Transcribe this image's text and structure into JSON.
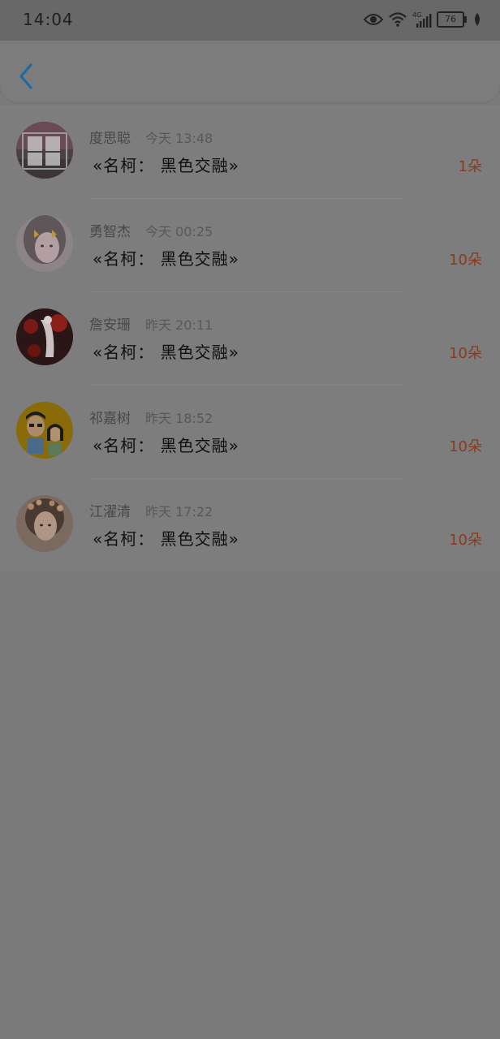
{
  "status_bar": {
    "time": "14:04",
    "network": "4G",
    "battery": "76",
    "icons": [
      "eye-icon",
      "wifi-icon",
      "signal-icon",
      "battery-icon",
      "leaf-icon"
    ]
  },
  "header": {
    "back_icon": "chevron-left-icon",
    "accent_color": "#1a6aa8"
  },
  "colors": {
    "count": "#8a3a1e",
    "title": "#0f0f0f",
    "name": "#484848"
  },
  "records": [
    {
      "name": "度思聪",
      "time": "今天 13:48",
      "title": "«名柯： 黑色交融»",
      "count": "1朵",
      "avatar": "avatar-text-image"
    },
    {
      "name": "勇智杰",
      "time": "今天 00:25",
      "title": "«名柯： 黑色交融»",
      "count": "10朵",
      "avatar": "avatar-girl-with-butterflies"
    },
    {
      "name": "詹安珊",
      "time": "昨天 20:11",
      "title": "«名柯： 黑色交融»",
      "count": "10朵",
      "avatar": "avatar-red-scene"
    },
    {
      "name": "祁嘉树",
      "time": "昨天 18:52",
      "title": "«名柯： 黑色交融»",
      "count": "10朵",
      "avatar": "avatar-cartoon-couple"
    },
    {
      "name": "江濯清",
      "time": "昨天 17:22",
      "title": "«名柯： 黑色交融»",
      "count": "10朵",
      "avatar": "avatar-girl-with-flowers"
    }
  ]
}
